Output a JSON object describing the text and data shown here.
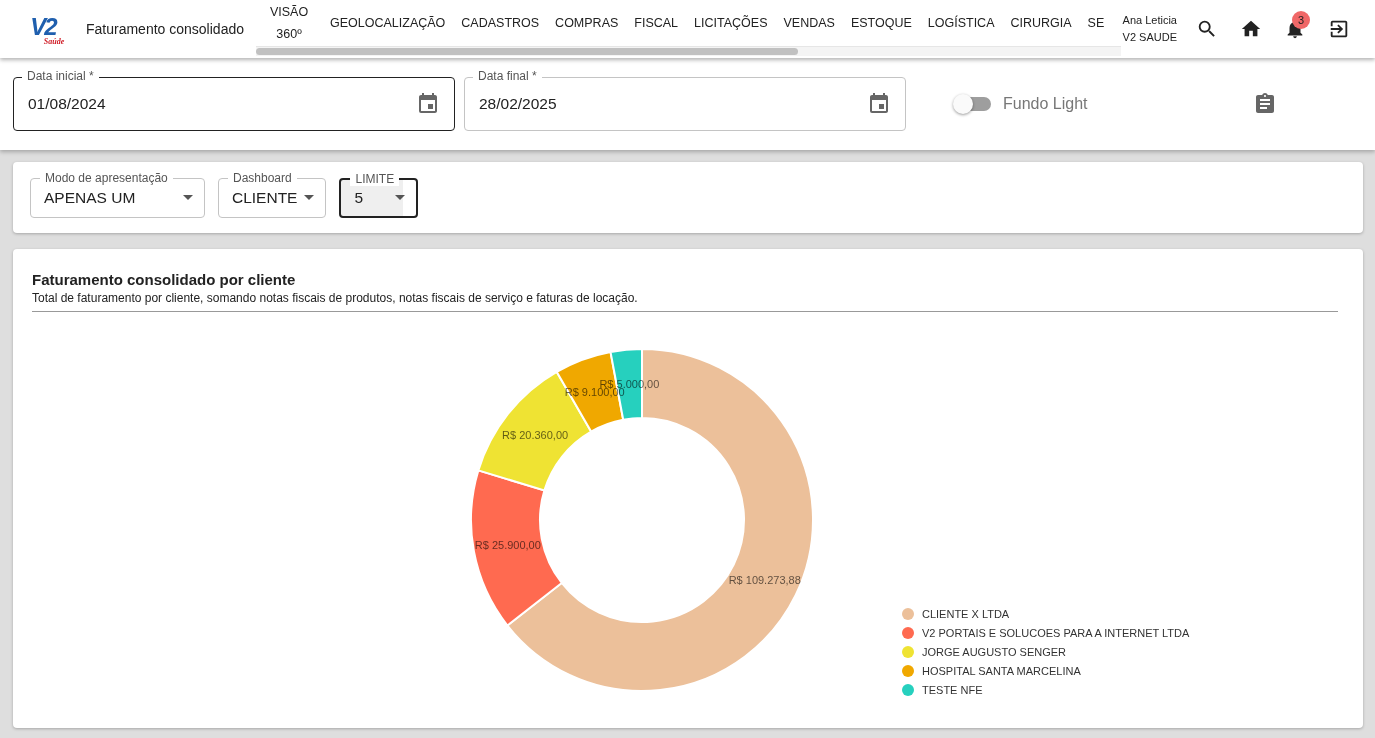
{
  "header": {
    "logo": {
      "mark": "V2",
      "sub": "Saúde"
    },
    "title": "Faturamento consolidado",
    "nav": [
      "VISÃO 360º",
      "GEOLOCALIZAÇÃO",
      "CADASTROS",
      "COMPRAS",
      "FISCAL",
      "LICITAÇÕES",
      "VENDAS",
      "ESTOQUE",
      "LOGÍSTICA",
      "CIRURGIA",
      "SE"
    ],
    "user": {
      "name": "Ana Leticia",
      "company": "V2 SAUDE"
    },
    "notifications": "3"
  },
  "dates": [
    {
      "label": "Data inicial *",
      "value": "01/08/2024",
      "focused": true
    },
    {
      "label": "Data final *",
      "value": "28/02/2025",
      "focused": false
    }
  ],
  "toggle": {
    "label": "Fundo Light",
    "on": false
  },
  "selects": [
    {
      "label": "Modo de apresentação",
      "value": "APENAS UM",
      "focused": false
    },
    {
      "label": "Dashboard",
      "value": "CLIENTE",
      "focused": false
    },
    {
      "label": "LIMITE",
      "value": "5",
      "focused": true
    }
  ],
  "chart": {
    "title": "Faturamento consolidado por cliente",
    "subtitle": "Total de faturamento por cliente, somando notas fiscais de produtos, notas fiscais de serviço e faturas de locação.",
    "chart_data": {
      "type": "donut",
      "categories": [
        "CLIENTE X LTDA",
        "V2 PORTAIS E SOLUCOES PARA A INTERNET LTDA",
        "JORGE AUGUSTO SENGER",
        "HOSPITAL SANTA MARCELINA",
        "TESTE NFE"
      ],
      "values": [
        109273.88,
        25900,
        20360,
        9100,
        5000
      ],
      "value_labels": [
        "R$ 109.273,88",
        "R$ 25.900,00",
        "R$ 20.360,00",
        "R$ 9.100,00",
        "R$ 5.000,00"
      ]
    },
    "legend": [
      {
        "color": "#ecc09a"
      },
      {
        "color": "#ff6a50"
      },
      {
        "color": "#efe333"
      },
      {
        "color": "#f0a800"
      },
      {
        "color": "#26d0be"
      }
    ]
  }
}
